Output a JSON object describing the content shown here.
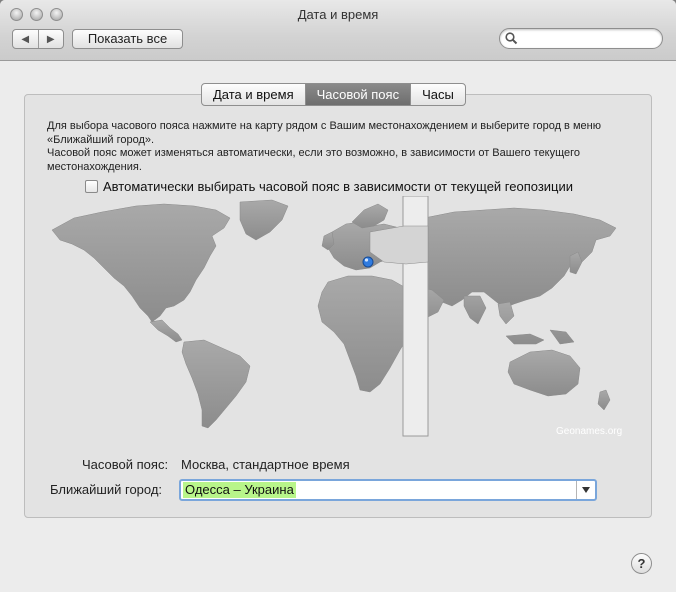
{
  "window": {
    "title": "Дата и время"
  },
  "toolbar": {
    "back": "◀",
    "forward": "▶",
    "show_all": "Показать все",
    "search_placeholder": ""
  },
  "tabs": [
    {
      "label": "Дата и время"
    },
    {
      "label": "Часовой пояс"
    },
    {
      "label": "Часы"
    }
  ],
  "active_tab": "Часовой пояс",
  "description": {
    "line1": "Для выбора часового пояса нажмите на карту рядом с Вашим местонахождением и выберите город в меню «Ближайший город».",
    "line2": "Часовой пояс может изменяться автоматически, если это возможно, в зависимости от Вашего текущего местонахождения."
  },
  "auto_timezone": {
    "label": "Автоматически выбирать часовой пояс в зависимости от текущей геопозиции",
    "checked": false
  },
  "map": {
    "credit": "Geonames.org"
  },
  "timezone": {
    "label": "Часовой пояс:",
    "value": "Москва, стандартное время"
  },
  "closest_city": {
    "label": "Ближайший город:",
    "value": "Одесса – Украина"
  },
  "help": {
    "label": "?"
  },
  "colors": {
    "highlight": "#b8f58a",
    "focus_ring": "#7aa6db",
    "active_tab": "#7a7a7a"
  }
}
